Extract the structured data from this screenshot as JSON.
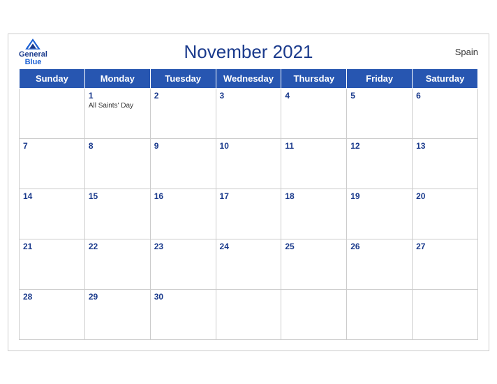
{
  "header": {
    "title": "November 2021",
    "country": "Spain",
    "logo": {
      "general": "General",
      "blue": "Blue"
    }
  },
  "days_of_week": [
    "Sunday",
    "Monday",
    "Tuesday",
    "Wednesday",
    "Thursday",
    "Friday",
    "Saturday"
  ],
  "weeks": [
    [
      {
        "day": "",
        "empty": true
      },
      {
        "day": "1",
        "event": "All Saints' Day"
      },
      {
        "day": "2",
        "event": ""
      },
      {
        "day": "3",
        "event": ""
      },
      {
        "day": "4",
        "event": ""
      },
      {
        "day": "5",
        "event": ""
      },
      {
        "day": "6",
        "event": ""
      }
    ],
    [
      {
        "day": "7",
        "event": ""
      },
      {
        "day": "8",
        "event": ""
      },
      {
        "day": "9",
        "event": ""
      },
      {
        "day": "10",
        "event": ""
      },
      {
        "day": "11",
        "event": ""
      },
      {
        "day": "12",
        "event": ""
      },
      {
        "day": "13",
        "event": ""
      }
    ],
    [
      {
        "day": "14",
        "event": ""
      },
      {
        "day": "15",
        "event": ""
      },
      {
        "day": "16",
        "event": ""
      },
      {
        "day": "17",
        "event": ""
      },
      {
        "day": "18",
        "event": ""
      },
      {
        "day": "19",
        "event": ""
      },
      {
        "day": "20",
        "event": ""
      }
    ],
    [
      {
        "day": "21",
        "event": ""
      },
      {
        "day": "22",
        "event": ""
      },
      {
        "day": "23",
        "event": ""
      },
      {
        "day": "24",
        "event": ""
      },
      {
        "day": "25",
        "event": ""
      },
      {
        "day": "26",
        "event": ""
      },
      {
        "day": "27",
        "event": ""
      }
    ],
    [
      {
        "day": "28",
        "event": ""
      },
      {
        "day": "29",
        "event": ""
      },
      {
        "day": "30",
        "event": ""
      },
      {
        "day": "",
        "empty": true
      },
      {
        "day": "",
        "empty": true
      },
      {
        "day": "",
        "empty": true
      },
      {
        "day": "",
        "empty": true
      }
    ]
  ]
}
